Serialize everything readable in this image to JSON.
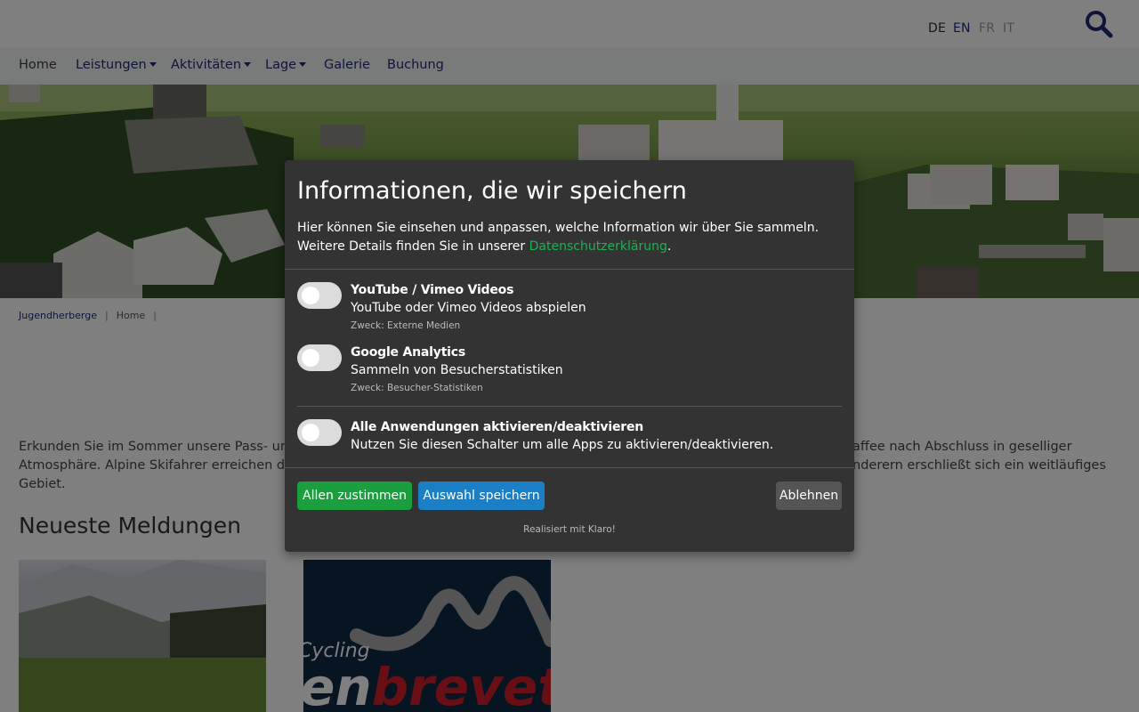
{
  "header": {
    "languages": [
      "DE",
      "EN",
      "FR",
      "IT"
    ],
    "search_icon": "magnifier-icon"
  },
  "nav": {
    "items": [
      "Home",
      "Leistungen",
      "Aktivitäten",
      "Lage",
      "Galerie",
      "Buchung"
    ]
  },
  "breadcrumb": [
    "Jugendherberge",
    "Home"
  ],
  "intro": {
    "left_text": "Erkunden Sie im Sommer unsere Pass- und Be",
    "right_text": "affee nach Abschluss in geselliger",
    "line2_left": "Atmosphäre. Alpine Skifahrer erreichen die Sk",
    "line2_right": "nderern erschließt sich ein weitläufiges",
    "line3": "Gebiet."
  },
  "news": {
    "title": "Neueste Meldungen",
    "card2_text_1": "Cycling",
    "card2_text_2": "enbrevet"
  },
  "modal": {
    "title": "Informationen, die wir speichern",
    "description": "Hier können Sie einsehen und anpassen, welche Information wir über Sie sammeln. Weitere Details finden Sie in unserer ",
    "privacy_link": "Datenschutzerklärung",
    "description_end": ".",
    "apps": [
      {
        "name": "YouTube / Vimeo Videos",
        "desc": "YouTube oder Vimeo Videos abspielen",
        "purpose": "Zweck: Externe Medien",
        "enabled": false
      },
      {
        "name": "Google Analytics",
        "desc": "Sammeln von Besucherstatistiken",
        "purpose": "Zweck: Besucher-Statistiken",
        "enabled": false
      }
    ],
    "toggle_all": {
      "name": "Alle Anwendungen aktivieren/deaktivieren",
      "desc": "Nutzen Sie diesen Schalter um alle Apps zu aktivieren/deaktivieren.",
      "enabled": false
    },
    "buttons": {
      "accept_all": "Allen zustimmen",
      "save": "Auswahl speichern",
      "decline": "Ablehnen"
    },
    "powered_by": "Realisiert mit Klaro!"
  },
  "colors": {
    "accept": "#1a9e3e",
    "save": "#1a7fc4",
    "decline": "#555555",
    "link": "#1db350",
    "nav": "#1d2b7a",
    "modal_bg": "#333333"
  }
}
